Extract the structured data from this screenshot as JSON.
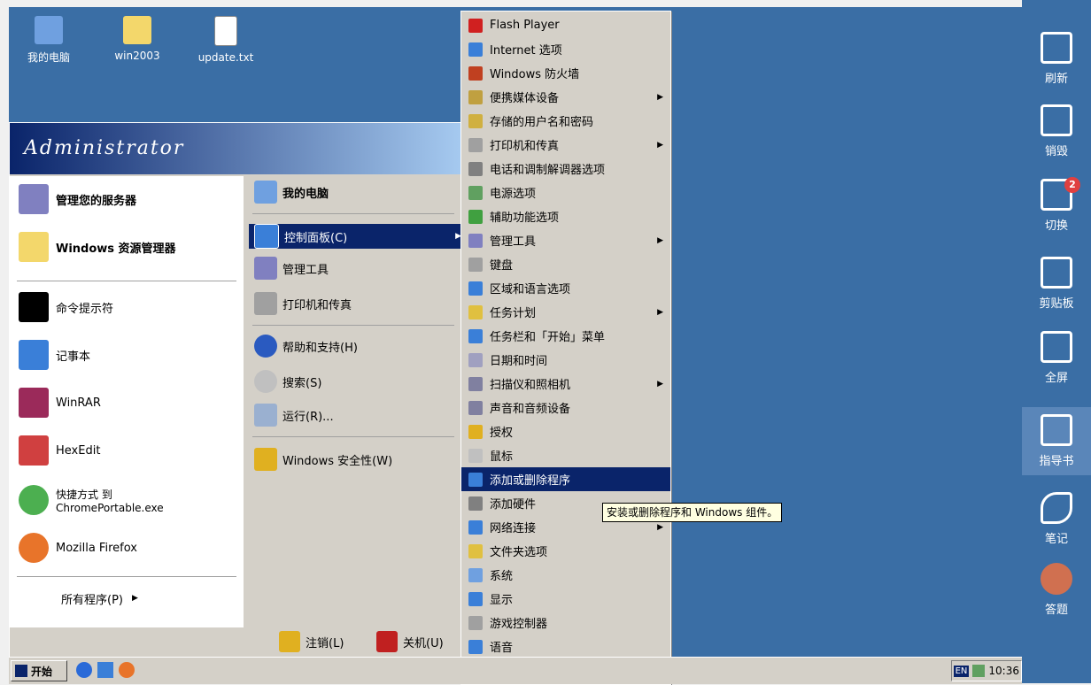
{
  "desktop_icons": [
    {
      "label": "我的电脑",
      "color": "#6fa0e0"
    },
    {
      "label": "win2003",
      "color": "#f3d76b"
    },
    {
      "label": "update.txt",
      "color": "#ffffff"
    }
  ],
  "start_menu": {
    "user": "Administrator",
    "left_items": [
      {
        "label": "管理您的服务器",
        "bold": true,
        "color": "#8080c0"
      },
      {
        "label": "Windows 资源管理器",
        "bold": true,
        "color": "#f3d76b"
      },
      {
        "label": "命令提示符",
        "color": "#000000"
      },
      {
        "label": "记事本",
        "color": "#3a7fd8"
      },
      {
        "label": "WinRAR",
        "color": "#9b2a5a"
      },
      {
        "label": "HexEdit",
        "color": "#d04040"
      },
      {
        "label": "快捷方式 到\nChromePortable.exe",
        "color": "#4caf50"
      },
      {
        "label": "Mozilla Firefox",
        "color": "#e8742a"
      }
    ],
    "all_programs": "所有程序(P)",
    "right_items": [
      {
        "label": "我的电脑",
        "bold": true,
        "color": "#6fa0e0"
      },
      {
        "label": "控制面板(C)",
        "color": "#3a7fd8",
        "selected": true
      },
      {
        "label": "管理工具",
        "color": "#8080c0"
      },
      {
        "label": "打印机和传真",
        "color": "#a0a0a0"
      },
      {
        "label": "帮助和支持(H)",
        "color": "#2a5ac0"
      },
      {
        "label": "搜索(S)",
        "color": "#c0c0c0"
      },
      {
        "label": "运行(R)...",
        "color": "#9ab0d0"
      },
      {
        "label": "Windows 安全性(W)",
        "color": "#e0b020"
      }
    ],
    "logoff": "注销(L)",
    "shutdown": "关机(U)"
  },
  "control_panel_items": [
    {
      "label": "Flash Player",
      "color": "#d02020",
      "arrow": false
    },
    {
      "label": "Internet 选项",
      "color": "#3a7fd8",
      "arrow": false
    },
    {
      "label": "Windows 防火墙",
      "color": "#c04020",
      "arrow": false
    },
    {
      "label": "便携媒体设备",
      "color": "#c0a040",
      "arrow": true
    },
    {
      "label": "存储的用户名和密码",
      "color": "#d0b040",
      "arrow": false
    },
    {
      "label": "打印机和传真",
      "color": "#a0a0a0",
      "arrow": true
    },
    {
      "label": "电话和调制解调器选项",
      "color": "#808080",
      "arrow": false
    },
    {
      "label": "电源选项",
      "color": "#60a060",
      "arrow": false
    },
    {
      "label": "辅助功能选项",
      "color": "#40a040",
      "arrow": false
    },
    {
      "label": "管理工具",
      "color": "#8080c0",
      "arrow": true
    },
    {
      "label": "键盘",
      "color": "#a0a0a0",
      "arrow": false
    },
    {
      "label": "区域和语言选项",
      "color": "#3a7fd8",
      "arrow": false
    },
    {
      "label": "任务计划",
      "color": "#e0c040",
      "arrow": true
    },
    {
      "label": "任务栏和「开始」菜单",
      "color": "#3a7fd8",
      "arrow": false
    },
    {
      "label": "日期和时间",
      "color": "#a0a0c0",
      "arrow": false
    },
    {
      "label": "扫描仪和照相机",
      "color": "#8080a0",
      "arrow": true
    },
    {
      "label": "声音和音频设备",
      "color": "#8080a0",
      "arrow": false
    },
    {
      "label": "授权",
      "color": "#e0b020",
      "arrow": false
    },
    {
      "label": "鼠标",
      "color": "#c0c0c0",
      "arrow": false
    },
    {
      "label": "添加或删除程序",
      "color": "#3a7fd8",
      "arrow": false,
      "selected": true
    },
    {
      "label": "添加硬件",
      "color": "#808080",
      "arrow": false
    },
    {
      "label": "网络连接",
      "color": "#3a7fd8",
      "arrow": true
    },
    {
      "label": "文件夹选项",
      "color": "#e0c040",
      "arrow": false
    },
    {
      "label": "系统",
      "color": "#6fa0e0",
      "arrow": false
    },
    {
      "label": "显示",
      "color": "#3a7fd8",
      "arrow": false
    },
    {
      "label": "游戏控制器",
      "color": "#a0a0a0",
      "arrow": false
    },
    {
      "label": "语音",
      "color": "#3a7fd8",
      "arrow": false
    }
  ],
  "tooltip": "安装或删除程序和 Windows 组件。",
  "taskbar": {
    "start": "开始",
    "lang": "EN",
    "time": "10:36"
  },
  "right_toolbar": [
    {
      "label": "刷新",
      "icon": "refresh-icon"
    },
    {
      "label": "销毁",
      "icon": "trash-icon"
    },
    {
      "label": "切换",
      "icon": "switch-icon",
      "badge": "2"
    },
    {
      "label": "剪贴板",
      "icon": "scissors-icon"
    },
    {
      "label": "全屏",
      "icon": "fullscreen-icon"
    },
    {
      "label": "指导书",
      "icon": "book-icon",
      "active": true
    },
    {
      "label": "笔记",
      "icon": "pencil-icon"
    },
    {
      "label": "答题",
      "icon": "answer-icon"
    }
  ]
}
